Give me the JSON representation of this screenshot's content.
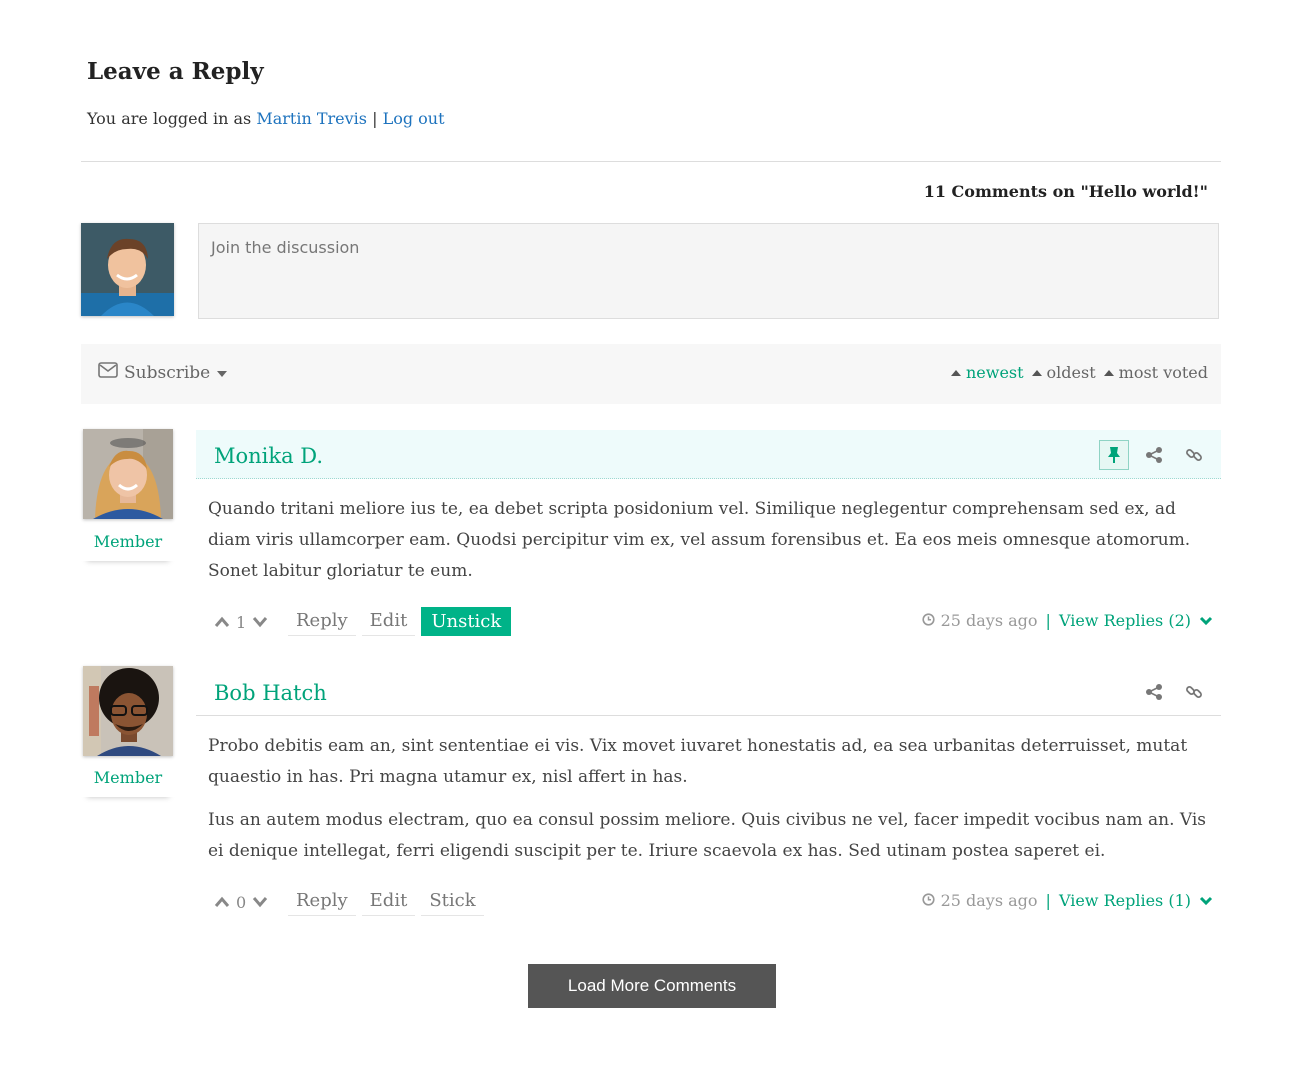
{
  "reply": {
    "title": "Leave a Reply",
    "logged_in_prefix": "You are logged in as",
    "user_name": "Martin Trevis",
    "separator": "|",
    "logout_label": "Log out"
  },
  "comments_count_label": "11 Comments on \"Hello world!\"",
  "compose": {
    "placeholder": "Join the discussion"
  },
  "toolbar": {
    "subscribe_label": "Subscribe",
    "sorts": [
      {
        "label": "newest",
        "active": true
      },
      {
        "label": "oldest",
        "active": false
      },
      {
        "label": "most voted",
        "active": false
      }
    ]
  },
  "comments": [
    {
      "author": "Monika D.",
      "role": "Member",
      "paragraphs": [
        "Quando tritani meliore ius te, ea debet scripta posidonium vel. Similique neglegentur comprehensam sed ex, ad diam viris ullamcorper eam. Quodsi percipitur vim ex, vel assum forensibus et. Ea eos meis omnesque atomorum. Sonet labitur gloriatur te eum."
      ],
      "votes": "1",
      "buttons": [
        "Reply",
        "Edit",
        "Unstick"
      ],
      "time": "25 days ago",
      "view_replies": "View Replies (2)"
    },
    {
      "author": "Bob Hatch",
      "role": "Member",
      "paragraphs": [
        "Probo debitis eam an, sint sententiae ei vis. Vix movet iuvaret honestatis ad, ea sea urbanitas deterruisset, mutat quaestio in has. Pri magna utamur ex, nisl affert in has.",
        "Ius an autem modus electram, quo ea consul possim meliore. Quis civibus ne vel, facer impedit vocibus nam an. Vis ei denique intellegat, ferri eligendi suscipit per te. Iriure scaevola ex has. Sed utinam postea saperet ei."
      ],
      "votes": "0",
      "buttons": [
        "Reply",
        "Edit",
        "Stick"
      ],
      "time": "25 days ago",
      "view_replies": "View Replies (1)"
    }
  ],
  "load_more_label": "Load More Comments",
  "colors": {
    "accent": "#00a37a",
    "link": "#1e73be",
    "button_dark": "#555555"
  }
}
